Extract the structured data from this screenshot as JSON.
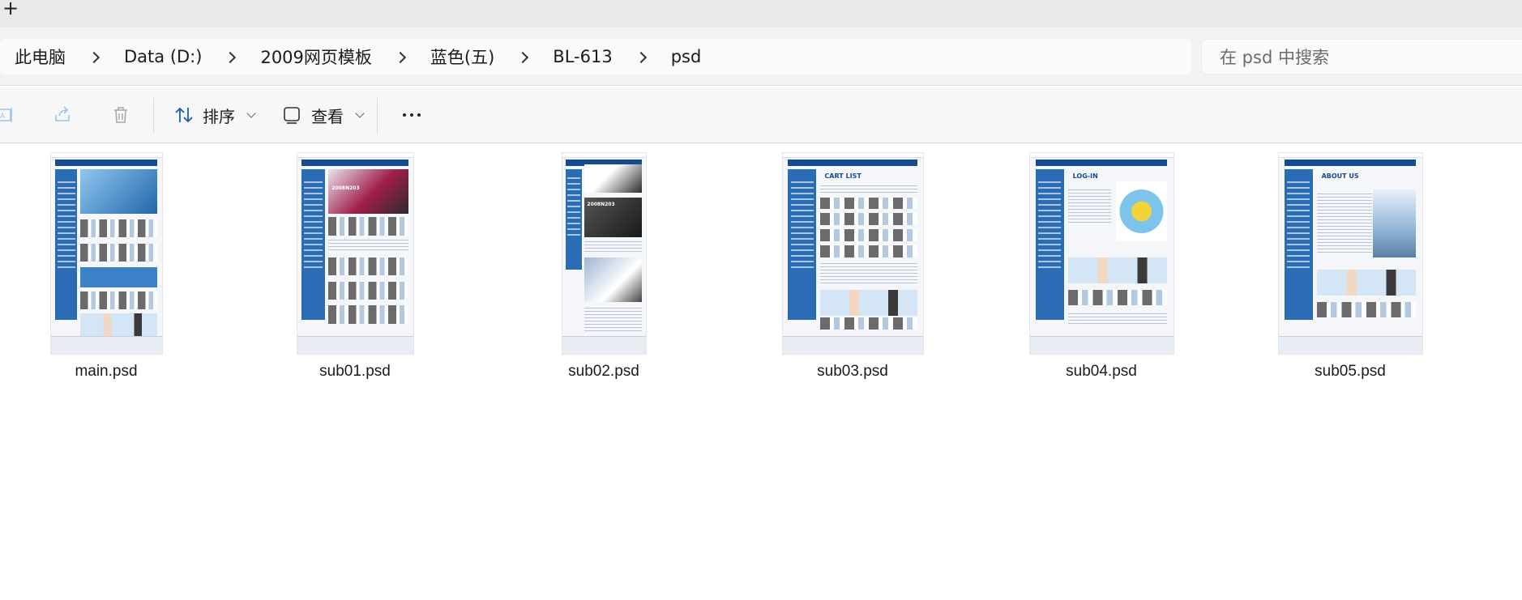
{
  "window": {
    "new_tab_glyph": "+"
  },
  "address_bar": {
    "crumbs": [
      "此电脑",
      "Data (D:)",
      "2009网页模板",
      "蓝色(五)",
      "BL-613",
      "psd"
    ],
    "search_placeholder": "在 psd 中搜索"
  },
  "command_bar": {
    "sort_label": "排序",
    "view_label": "查看",
    "icons": [
      "rename-icon",
      "share-icon",
      "delete-icon",
      "sort-icon",
      "view-icon",
      "more-icon"
    ]
  },
  "files": [
    {
      "name": "main.psd",
      "thumb_title": ""
    },
    {
      "name": "sub01.psd",
      "thumb_title": "2008N203"
    },
    {
      "name": "sub02.psd",
      "thumb_title": "2008N203"
    },
    {
      "name": "sub03.psd",
      "thumb_title": "CART LIST"
    },
    {
      "name": "sub04.psd",
      "thumb_title": "LOG-IN"
    },
    {
      "name": "sub05.psd",
      "thumb_title": "ABOUT US"
    }
  ],
  "colors": {
    "accent": "#154c8f",
    "icon_blue": "#1f5fa8"
  }
}
